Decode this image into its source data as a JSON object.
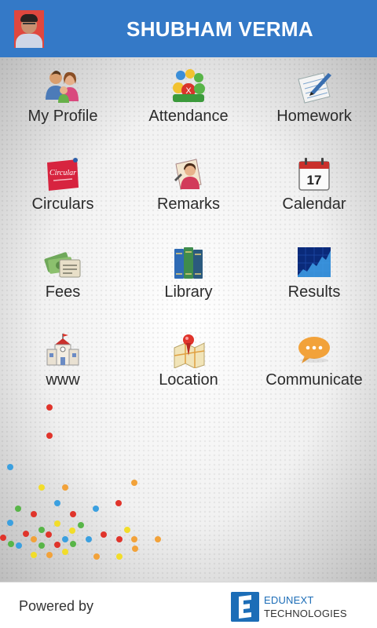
{
  "header": {
    "user_name": "SHUBHAM VERMA"
  },
  "menu": [
    {
      "label": "My Profile",
      "icon": "profile-icon"
    },
    {
      "label": "Attendance",
      "icon": "attendance-icon"
    },
    {
      "label": "Homework",
      "icon": "homework-icon"
    },
    {
      "label": "Circulars",
      "icon": "circular-icon",
      "icon_text": "Circular"
    },
    {
      "label": "Remarks",
      "icon": "remarks-icon"
    },
    {
      "label": "Calendar",
      "icon": "calendar-icon",
      "icon_text": "17"
    },
    {
      "label": "Fees",
      "icon": "fees-icon"
    },
    {
      "label": "Library",
      "icon": "library-icon"
    },
    {
      "label": "Results",
      "icon": "results-icon"
    },
    {
      "label": "www",
      "icon": "school-icon"
    },
    {
      "label": "Location",
      "icon": "location-icon"
    },
    {
      "label": "Communicate",
      "icon": "chat-icon"
    }
  ],
  "footer": {
    "powered_by": "Powered by",
    "brand_line1": "EDUNEXT",
    "brand_line2": "TECHNOLOGIES"
  },
  "colors": {
    "header": "#3479c7",
    "brand": "#1c6db7"
  }
}
